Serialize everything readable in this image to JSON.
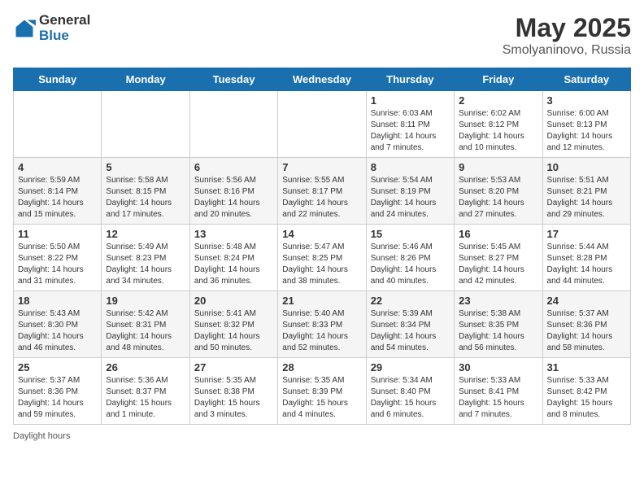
{
  "header": {
    "logo_general": "General",
    "logo_blue": "Blue",
    "month_title": "May 2025",
    "location": "Smolyaninovo, Russia"
  },
  "weekdays": [
    "Sunday",
    "Monday",
    "Tuesday",
    "Wednesday",
    "Thursday",
    "Friday",
    "Saturday"
  ],
  "weeks": [
    [
      {
        "day": "",
        "info": ""
      },
      {
        "day": "",
        "info": ""
      },
      {
        "day": "",
        "info": ""
      },
      {
        "day": "",
        "info": ""
      },
      {
        "day": "1",
        "info": "Sunrise: 6:03 AM\nSunset: 8:11 PM\nDaylight: 14 hours\nand 7 minutes."
      },
      {
        "day": "2",
        "info": "Sunrise: 6:02 AM\nSunset: 8:12 PM\nDaylight: 14 hours\nand 10 minutes."
      },
      {
        "day": "3",
        "info": "Sunrise: 6:00 AM\nSunset: 8:13 PM\nDaylight: 14 hours\nand 12 minutes."
      }
    ],
    [
      {
        "day": "4",
        "info": "Sunrise: 5:59 AM\nSunset: 8:14 PM\nDaylight: 14 hours\nand 15 minutes."
      },
      {
        "day": "5",
        "info": "Sunrise: 5:58 AM\nSunset: 8:15 PM\nDaylight: 14 hours\nand 17 minutes."
      },
      {
        "day": "6",
        "info": "Sunrise: 5:56 AM\nSunset: 8:16 PM\nDaylight: 14 hours\nand 20 minutes."
      },
      {
        "day": "7",
        "info": "Sunrise: 5:55 AM\nSunset: 8:17 PM\nDaylight: 14 hours\nand 22 minutes."
      },
      {
        "day": "8",
        "info": "Sunrise: 5:54 AM\nSunset: 8:19 PM\nDaylight: 14 hours\nand 24 minutes."
      },
      {
        "day": "9",
        "info": "Sunrise: 5:53 AM\nSunset: 8:20 PM\nDaylight: 14 hours\nand 27 minutes."
      },
      {
        "day": "10",
        "info": "Sunrise: 5:51 AM\nSunset: 8:21 PM\nDaylight: 14 hours\nand 29 minutes."
      }
    ],
    [
      {
        "day": "11",
        "info": "Sunrise: 5:50 AM\nSunset: 8:22 PM\nDaylight: 14 hours\nand 31 minutes."
      },
      {
        "day": "12",
        "info": "Sunrise: 5:49 AM\nSunset: 8:23 PM\nDaylight: 14 hours\nand 34 minutes."
      },
      {
        "day": "13",
        "info": "Sunrise: 5:48 AM\nSunset: 8:24 PM\nDaylight: 14 hours\nand 36 minutes."
      },
      {
        "day": "14",
        "info": "Sunrise: 5:47 AM\nSunset: 8:25 PM\nDaylight: 14 hours\nand 38 minutes."
      },
      {
        "day": "15",
        "info": "Sunrise: 5:46 AM\nSunset: 8:26 PM\nDaylight: 14 hours\nand 40 minutes."
      },
      {
        "day": "16",
        "info": "Sunrise: 5:45 AM\nSunset: 8:27 PM\nDaylight: 14 hours\nand 42 minutes."
      },
      {
        "day": "17",
        "info": "Sunrise: 5:44 AM\nSunset: 8:28 PM\nDaylight: 14 hours\nand 44 minutes."
      }
    ],
    [
      {
        "day": "18",
        "info": "Sunrise: 5:43 AM\nSunset: 8:30 PM\nDaylight: 14 hours\nand 46 minutes."
      },
      {
        "day": "19",
        "info": "Sunrise: 5:42 AM\nSunset: 8:31 PM\nDaylight: 14 hours\nand 48 minutes."
      },
      {
        "day": "20",
        "info": "Sunrise: 5:41 AM\nSunset: 8:32 PM\nDaylight: 14 hours\nand 50 minutes."
      },
      {
        "day": "21",
        "info": "Sunrise: 5:40 AM\nSunset: 8:33 PM\nDaylight: 14 hours\nand 52 minutes."
      },
      {
        "day": "22",
        "info": "Sunrise: 5:39 AM\nSunset: 8:34 PM\nDaylight: 14 hours\nand 54 minutes."
      },
      {
        "day": "23",
        "info": "Sunrise: 5:38 AM\nSunset: 8:35 PM\nDaylight: 14 hours\nand 56 minutes."
      },
      {
        "day": "24",
        "info": "Sunrise: 5:37 AM\nSunset: 8:36 PM\nDaylight: 14 hours\nand 58 minutes."
      }
    ],
    [
      {
        "day": "25",
        "info": "Sunrise: 5:37 AM\nSunset: 8:36 PM\nDaylight: 14 hours\nand 59 minutes."
      },
      {
        "day": "26",
        "info": "Sunrise: 5:36 AM\nSunset: 8:37 PM\nDaylight: 15 hours\nand 1 minute."
      },
      {
        "day": "27",
        "info": "Sunrise: 5:35 AM\nSunset: 8:38 PM\nDaylight: 15 hours\nand 3 minutes."
      },
      {
        "day": "28",
        "info": "Sunrise: 5:35 AM\nSunset: 8:39 PM\nDaylight: 15 hours\nand 4 minutes."
      },
      {
        "day": "29",
        "info": "Sunrise: 5:34 AM\nSunset: 8:40 PM\nDaylight: 15 hours\nand 6 minutes."
      },
      {
        "day": "30",
        "info": "Sunrise: 5:33 AM\nSunset: 8:41 PM\nDaylight: 15 hours\nand 7 minutes."
      },
      {
        "day": "31",
        "info": "Sunrise: 5:33 AM\nSunset: 8:42 PM\nDaylight: 15 hours\nand 8 minutes."
      }
    ]
  ],
  "footer": {
    "daylight_label": "Daylight hours"
  }
}
